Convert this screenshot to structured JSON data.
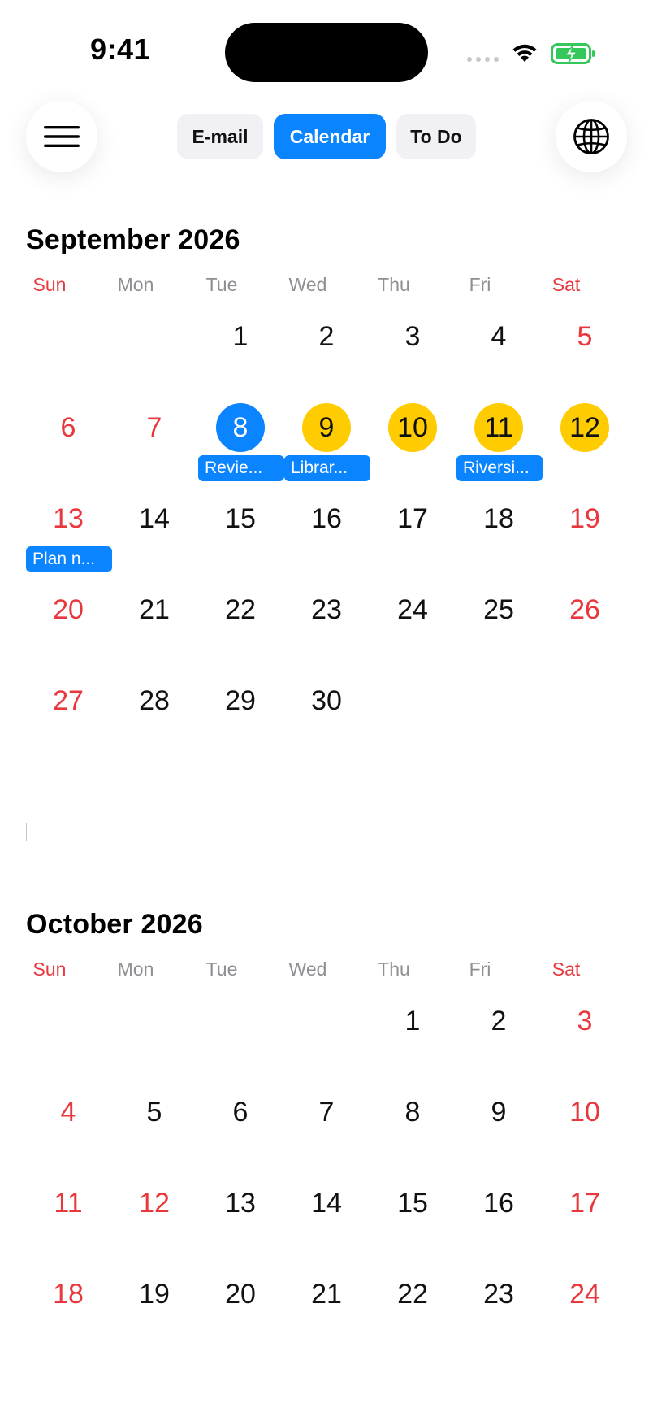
{
  "status_bar": {
    "time": "9:41"
  },
  "header": {
    "menu_icon": "hamburger-menu-icon",
    "globe_icon": "globe-icon",
    "tabs": [
      {
        "label": "E-mail",
        "active": false
      },
      {
        "label": "Calendar",
        "active": true
      },
      {
        "label": "To Do",
        "active": false
      }
    ]
  },
  "colors": {
    "accent": "#0a84ff",
    "highlight": "#ffcc02",
    "weekend": "#e8383d",
    "muted": "#8e8e93"
  },
  "weekdays": [
    "Sun",
    "Mon",
    "Tue",
    "Wed",
    "Thu",
    "Fri",
    "Sat"
  ],
  "months": [
    {
      "title": "September 2026",
      "first_weekday": 2,
      "days": 30,
      "today": 8,
      "highlighted": [
        9,
        10,
        11,
        12
      ],
      "red_days": [
        5,
        6,
        7,
        13,
        19,
        20,
        26,
        27
      ],
      "events": [
        {
          "day": 8,
          "label": "Revie..."
        },
        {
          "day": 9,
          "label": "Librar..."
        },
        {
          "day": 11,
          "label": "Riversi..."
        },
        {
          "day": 13,
          "label": "Plan n..."
        }
      ]
    },
    {
      "title": "October 2026",
      "first_weekday": 4,
      "days": 24,
      "today": null,
      "highlighted": [],
      "red_days": [
        3,
        4,
        10,
        11,
        12,
        17,
        18,
        24
      ],
      "events": []
    }
  ]
}
